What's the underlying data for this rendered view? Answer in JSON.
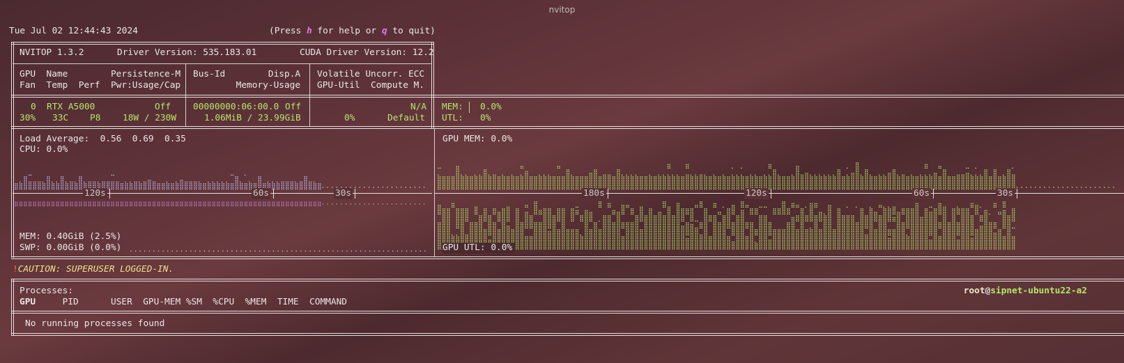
{
  "window": {
    "title": "nvitop"
  },
  "header": {
    "datetime": "Tue Jul 02 12:44:43 2024",
    "help_pre": "(Press ",
    "help_key": "h",
    "help_mid": " for help or ",
    "quit_key": "q",
    "help_post": " to quit)"
  },
  "summary": {
    "version": "NVITOP 1.3.2",
    "driver": "Driver Version: 535.183.01",
    "cuda": "CUDA Driver Version: 12.2"
  },
  "columns": {
    "c1a": "GPU  Name        Persistence-M",
    "c1b": "Fan  Temp  Perf  Pwr:Usage/Cap",
    "c2a": "Bus-Id        Disp.A",
    "c2b": "        Memory-Usage",
    "c3a": "Volatile Uncorr. ECC",
    "c3b": "GPU-Util  Compute M."
  },
  "gpu": {
    "index": "0",
    "name": "RTX A5000",
    "persistence": "Off",
    "fan": "30%",
    "temp": "33C",
    "perf": "P8",
    "power": "18W / 230W",
    "bus_id": "00000000:06:00.0",
    "disp": "Off",
    "memory": "1.06MiB / 23.99GiB",
    "ecc": "N/A",
    "util": "0%",
    "compute": "Default",
    "mem_label": "MEM:",
    "mem_value": "0.0%",
    "utl_label": "UTL:",
    "utl_value": "0%"
  },
  "host": {
    "load_avg": "Load Average:  0.56  0.69  0.35",
    "cpu": "CPU: 0.0%",
    "mem": "MEM: 0.40GiB (2.5%)",
    "swp": "SWP: 0.00GiB (0.0%)",
    "ticks": [
      "120s",
      "60s",
      "30s"
    ]
  },
  "gpu_graph": {
    "mem": "GPU MEM: 0.0%",
    "utl": "GPU UTL: 0.0%",
    "ticks": [
      "180s",
      "120s",
      "60s",
      "30s"
    ]
  },
  "caution": {
    "bang": "!",
    "text": "CAUTION: SUPERUSER LOGGED-IN."
  },
  "processes": {
    "title": "Processes:",
    "user": "root",
    "at": "@",
    "host": "sipnet-ubuntu22-a2",
    "headers": "     PID      USER  GPU-MEM %SM  %CPU  %MEM  TIME  COMMAND",
    "gpu_header": "GPU",
    "empty": "No running processes found"
  },
  "colors": {
    "green": "#b9e36c",
    "magenta": "#e07ae8",
    "caution": "#f0e08a",
    "bang": "#ff6a5a"
  }
}
